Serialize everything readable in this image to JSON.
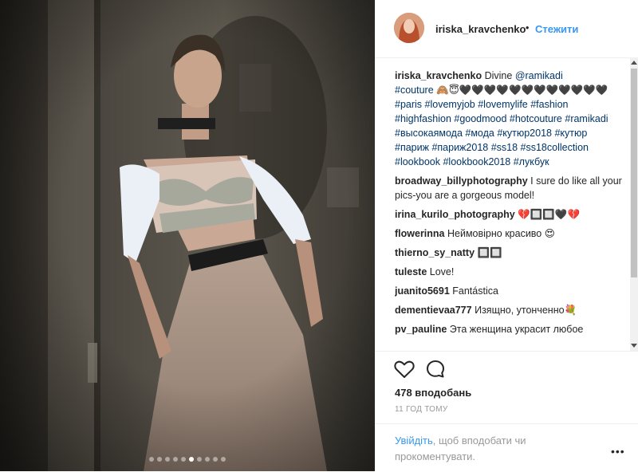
{
  "photo": {
    "carousel_count": 10,
    "carousel_active": 5
  },
  "header": {
    "username": "iriska_kravchenko",
    "separator": "•",
    "follow_label": "Стежити"
  },
  "caption": {
    "username": "iriska_kravchenko",
    "text_before": "Divine ",
    "mention": "@ramikadi",
    "hashtags_line1": "#couture",
    "emoji_line1": " 🙈😇🖤🖤🖤🖤🖤🖤🖤🖤🖤🖤🖤🖤",
    "hashtags": "#paris #lovemyjob #lovemylife #fashion #highfashion #goodmood #hotcouture #ramikadi #высокаямода #мода #кутюр2018 #кутюр #париж #париж2018 #ss18 #ss18collection #lookbook #lookbook2018 #лукбук"
  },
  "comments": [
    {
      "user": "broadway_billyphotography",
      "text": "I sure do like all your pics-you are a gorgeous model!"
    },
    {
      "user": "irina_kurilo_photography",
      "text": "💔🔲🔲🖤💔"
    },
    {
      "user": "flowerinna",
      "text": "Неймовірно красиво 😍"
    },
    {
      "user": "thierno_sy_natty",
      "text": "🔲🔲"
    },
    {
      "user": "tuleste",
      "text": "Love!"
    },
    {
      "user": "juanito5691",
      "text": "Fantástica"
    },
    {
      "user": "dementievaa777",
      "text": "Изящно, утонченно💐"
    },
    {
      "user": "pv_pauline",
      "text": "Эта женщина украсит любое"
    }
  ],
  "actions": {
    "like_icon": "heart-icon",
    "comment_icon": "comment-icon",
    "likes_text": "478 вподобань",
    "time_text": "11 ГОД ТОМУ"
  },
  "footer": {
    "login_link": "Увійдіть",
    "login_rest": ", щоб вподобати чи прокоментувати.",
    "more_label": "•••"
  }
}
